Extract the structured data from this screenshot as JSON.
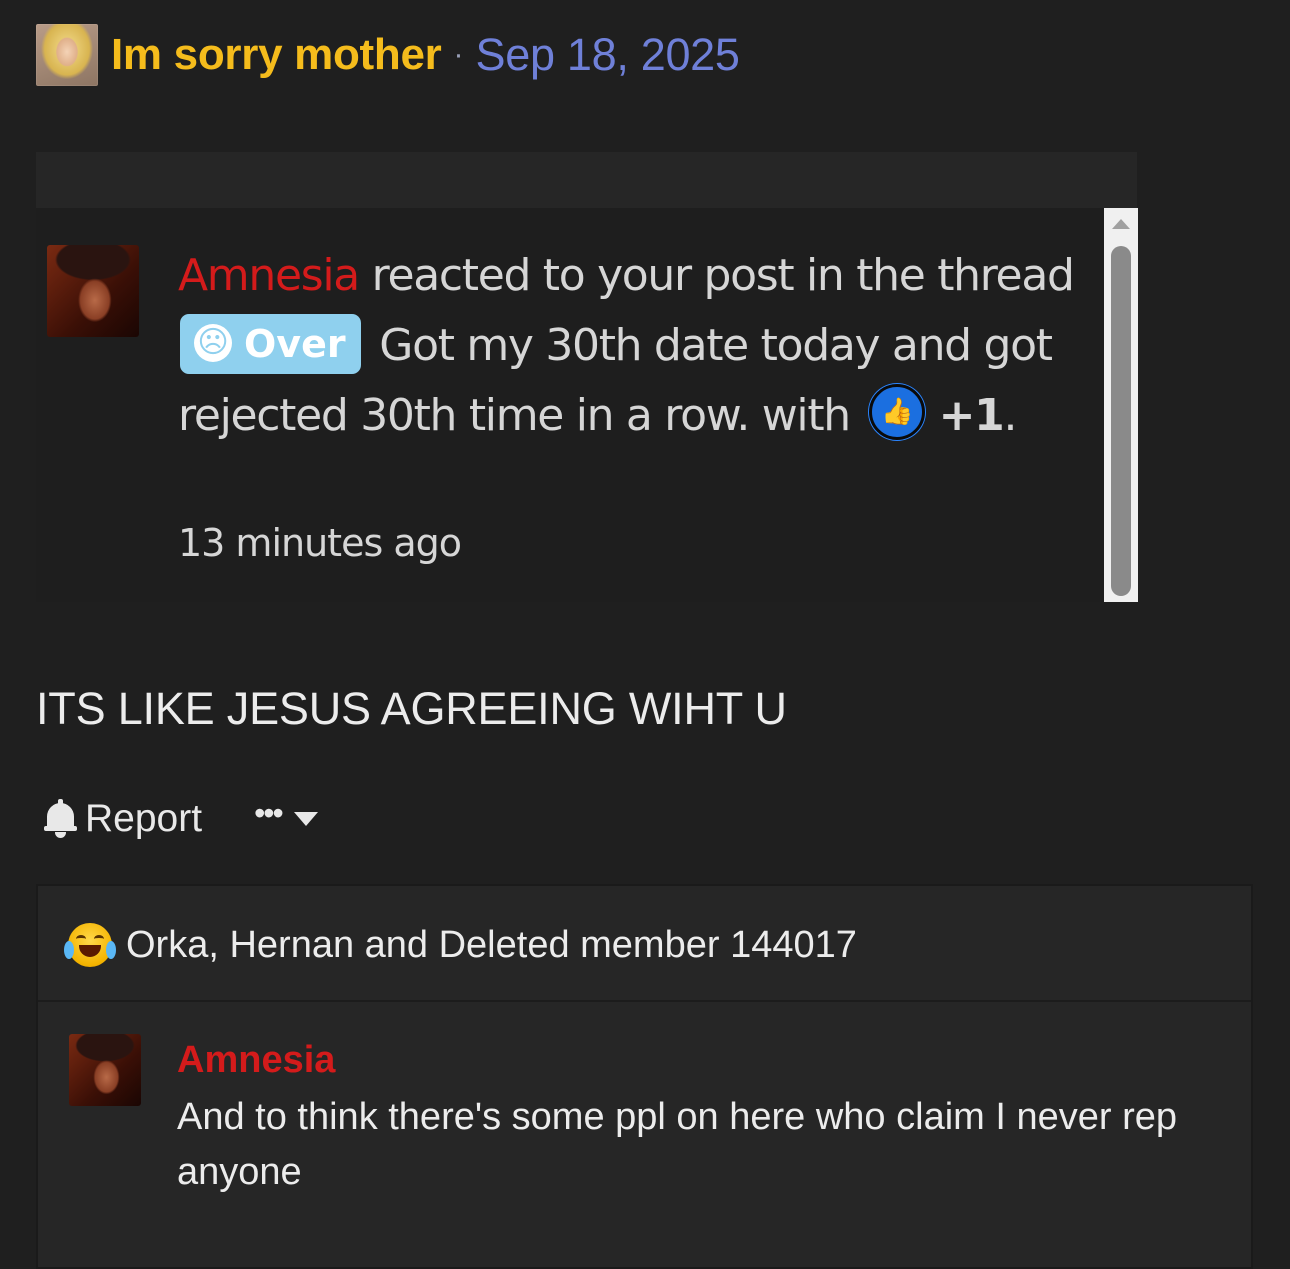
{
  "post": {
    "author": "Im sorry mother",
    "separator": "·",
    "date": "Sep 18, 2025",
    "message": "ITS LIKE JESUS AGREEING WIHT U"
  },
  "embedded_alert": {
    "user": "Amnesia",
    "text_1": " reacted to your post in the thread ",
    "prefix_label": "Over",
    "prefix_icon": "sad-face-icon",
    "text_2": " Got my 30th date today and got rejected 30th time in a row. with ",
    "reaction_icon": "thumbs-up-icon",
    "reaction_count": "+1",
    "text_3": ".",
    "time": "13 minutes ago"
  },
  "actions": {
    "report_label": "Report",
    "more_label": "•••"
  },
  "reactions": {
    "icon": "laughing-crying-icon",
    "summary": "Orka, Hernan and Deleted member 144017"
  },
  "comment": {
    "user": "Amnesia",
    "text": "And to think there's some ppl on here who claim I never rep anyone"
  },
  "colors": {
    "background": "#1f1f1f",
    "author": "#f5bc1c",
    "date": "#6f80d8",
    "username_red": "#d41b1b",
    "prefix_badge": "#8fd0ee",
    "like_blue": "#1b6fe0"
  }
}
